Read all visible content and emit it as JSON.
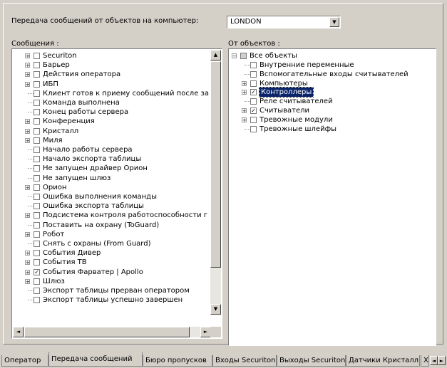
{
  "header": {
    "label": "Передача сообщений от объектов на компьютер:",
    "computer_value": "LONDON"
  },
  "messages": {
    "label": "Сообщения :",
    "items": [
      {
        "text": "Securiton",
        "expand": true,
        "state": "none"
      },
      {
        "text": "Барьер",
        "expand": true,
        "state": "none"
      },
      {
        "text": "Действия оператора",
        "expand": true,
        "state": "none"
      },
      {
        "text": "ИБП",
        "expand": true,
        "state": "none"
      },
      {
        "text": "Клиент готов к приему сообщений после за",
        "expand": false,
        "state": "none"
      },
      {
        "text": "Команда выполнена",
        "expand": false,
        "state": "none"
      },
      {
        "text": "Конец работы сервера",
        "expand": false,
        "state": "none"
      },
      {
        "text": "Конференция",
        "expand": true,
        "state": "none"
      },
      {
        "text": "Кристалл",
        "expand": true,
        "state": "none"
      },
      {
        "text": "Миля",
        "expand": true,
        "state": "none"
      },
      {
        "text": "Начало работы сервера",
        "expand": false,
        "state": "none"
      },
      {
        "text": "Начало экспорта таблицы",
        "expand": false,
        "state": "none"
      },
      {
        "text": "Не запущен драйвер Орион",
        "expand": false,
        "state": "none"
      },
      {
        "text": "Не запущен шлюз",
        "expand": false,
        "state": "none"
      },
      {
        "text": "Орион",
        "expand": true,
        "state": "none"
      },
      {
        "text": "Ошибка выполнения команды",
        "expand": false,
        "state": "none"
      },
      {
        "text": "Ошибка экспорта таблицы",
        "expand": false,
        "state": "none"
      },
      {
        "text": "Подсистема контроля работоспособности г",
        "expand": true,
        "state": "none"
      },
      {
        "text": "Поставить на охрану (ToGuard)",
        "expand": false,
        "state": "none"
      },
      {
        "text": "Робот",
        "expand": true,
        "state": "none"
      },
      {
        "text": "Снять с охраны (From Guard)",
        "expand": false,
        "state": "none"
      },
      {
        "text": "События Дивер",
        "expand": true,
        "state": "none"
      },
      {
        "text": "События ТВ",
        "expand": true,
        "state": "none"
      },
      {
        "text": "События Фарватер | Apollo",
        "expand": true,
        "state": "checked"
      },
      {
        "text": "Шлюз",
        "expand": true,
        "state": "none"
      },
      {
        "text": "Экспорт таблицы прерван оператором",
        "expand": false,
        "state": "none"
      },
      {
        "text": "Экспорт таблицы успешно завершен",
        "expand": false,
        "state": "none"
      }
    ]
  },
  "objects": {
    "label": "От объектов :",
    "root": {
      "text": "Все объекты",
      "state": "partial"
    },
    "items": [
      {
        "text": "Внутренние переменные",
        "expand": false,
        "state": "none",
        "selected": false
      },
      {
        "text": "Вспомогательные входы считывателей",
        "expand": false,
        "state": "none",
        "selected": false
      },
      {
        "text": "Компьютеры",
        "expand": true,
        "state": "none",
        "selected": false
      },
      {
        "text": "Контроллеры",
        "expand": true,
        "state": "checked",
        "selected": true
      },
      {
        "text": "Реле считывателей",
        "expand": false,
        "state": "none",
        "selected": false
      },
      {
        "text": "Считыватели",
        "expand": true,
        "state": "checked",
        "selected": false
      },
      {
        "text": "Тревожные модули",
        "expand": true,
        "state": "none",
        "selected": false
      },
      {
        "text": "Тревожные шлейфы",
        "expand": false,
        "state": "none",
        "selected": false
      }
    ]
  },
  "tabs": [
    {
      "label": "Оператор",
      "active": false
    },
    {
      "label": "Передача сообщений",
      "active": true
    },
    {
      "label": "Бюро пропусков",
      "active": false
    },
    {
      "label": "Входы Securiton",
      "active": false
    },
    {
      "label": "Выходы Securiton",
      "active": false
    },
    {
      "label": "Датчики Кристалл",
      "active": false
    },
    {
      "label": "Х",
      "active": false
    }
  ],
  "icons": {
    "dropdown": "chevron-down-icon",
    "expand": "plus-icon",
    "collapse": "minus-icon",
    "check": "checkmark-icon"
  }
}
